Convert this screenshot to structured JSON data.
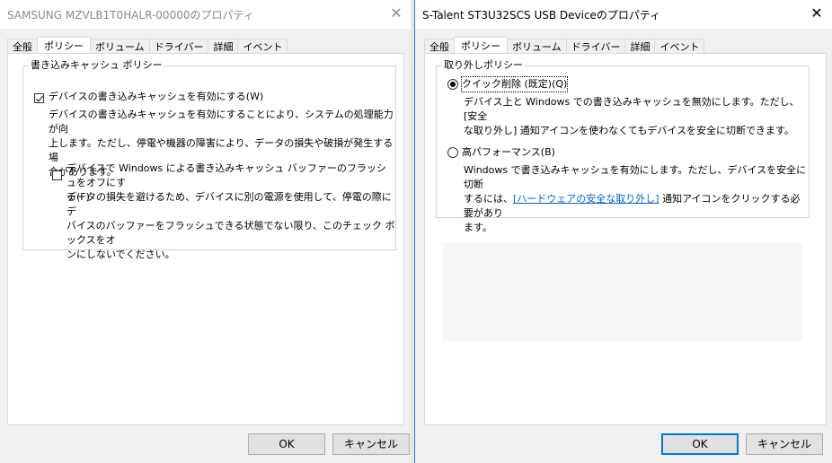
{
  "left": {
    "title": "SAMSUNG MZVLB1T0HALR-00000のプロパティ",
    "close_glyph": "✕",
    "tabs": [
      {
        "label": "全般"
      },
      {
        "label": "ポリシー"
      },
      {
        "label": "ボリューム"
      },
      {
        "label": "ドライバー"
      },
      {
        "label": "詳細"
      },
      {
        "label": "イベント"
      }
    ],
    "group_title": "書き込みキャッシュ ポリシー",
    "option1": {
      "label": "デバイスの書き込みキャッシュを有効にする(W)",
      "desc_lines": [
        "デバイスの書き込みキャッシュを有効にすることにより、システムの処理能力が向",
        "上します。ただし、停電や機器の障害により、データの損失や破損が発生する場",
        "合があります。"
      ],
      "checked": true
    },
    "option2": {
      "label_lines": [
        "デバイスで Windows による書き込みキャッシュ バッファーのフラッシュをオフにす",
        "る(F)"
      ],
      "desc_lines": [
        "データの損失を避けるため、デバイスに別の電源を使用して、停電の際にデ",
        "バイスのバッファーをフラッシュできる状態でない限り、このチェック ボックスをオ",
        "ンにしないでください。"
      ],
      "checked": false
    },
    "ok_label": "OK",
    "cancel_label": "キャンセル"
  },
  "right": {
    "title": "S-Talent ST3U32SCS USB Deviceのプロパティ",
    "close_glyph": "✕",
    "tabs": [
      {
        "label": "全般"
      },
      {
        "label": "ポリシー"
      },
      {
        "label": "ボリューム"
      },
      {
        "label": "ドライバー"
      },
      {
        "label": "詳細"
      },
      {
        "label": "イベント"
      }
    ],
    "group_title": "取り外しポリシー",
    "option1": {
      "label": "クイック削除 (既定)(Q)",
      "desc_lines": [
        "デバイス上と Windows での書き込みキャッシュを無効にします。ただし、[安全",
        "な取り外し] 通知アイコンを使わなくてもデバイスを安全に切断できます。"
      ],
      "selected": true
    },
    "option2": {
      "label": "高パフォーマンス(B)",
      "desc_line1": "Windows で書き込みキャッシュを有効にします。ただし、デバイスを安全に切断",
      "desc_line2_prefix": "するには、",
      "desc_link": "[ハードウェアの安全な取り外し]",
      "desc_line2_suffix": " 通知アイコンをクリックする必要があり",
      "desc_line3": "ます。",
      "selected": false
    },
    "ok_label": "OK",
    "cancel_label": "キャンセル"
  },
  "colors": {
    "accent": "#0078d7",
    "link": "#0066cc",
    "inactive_title": "#8a8a8a"
  }
}
